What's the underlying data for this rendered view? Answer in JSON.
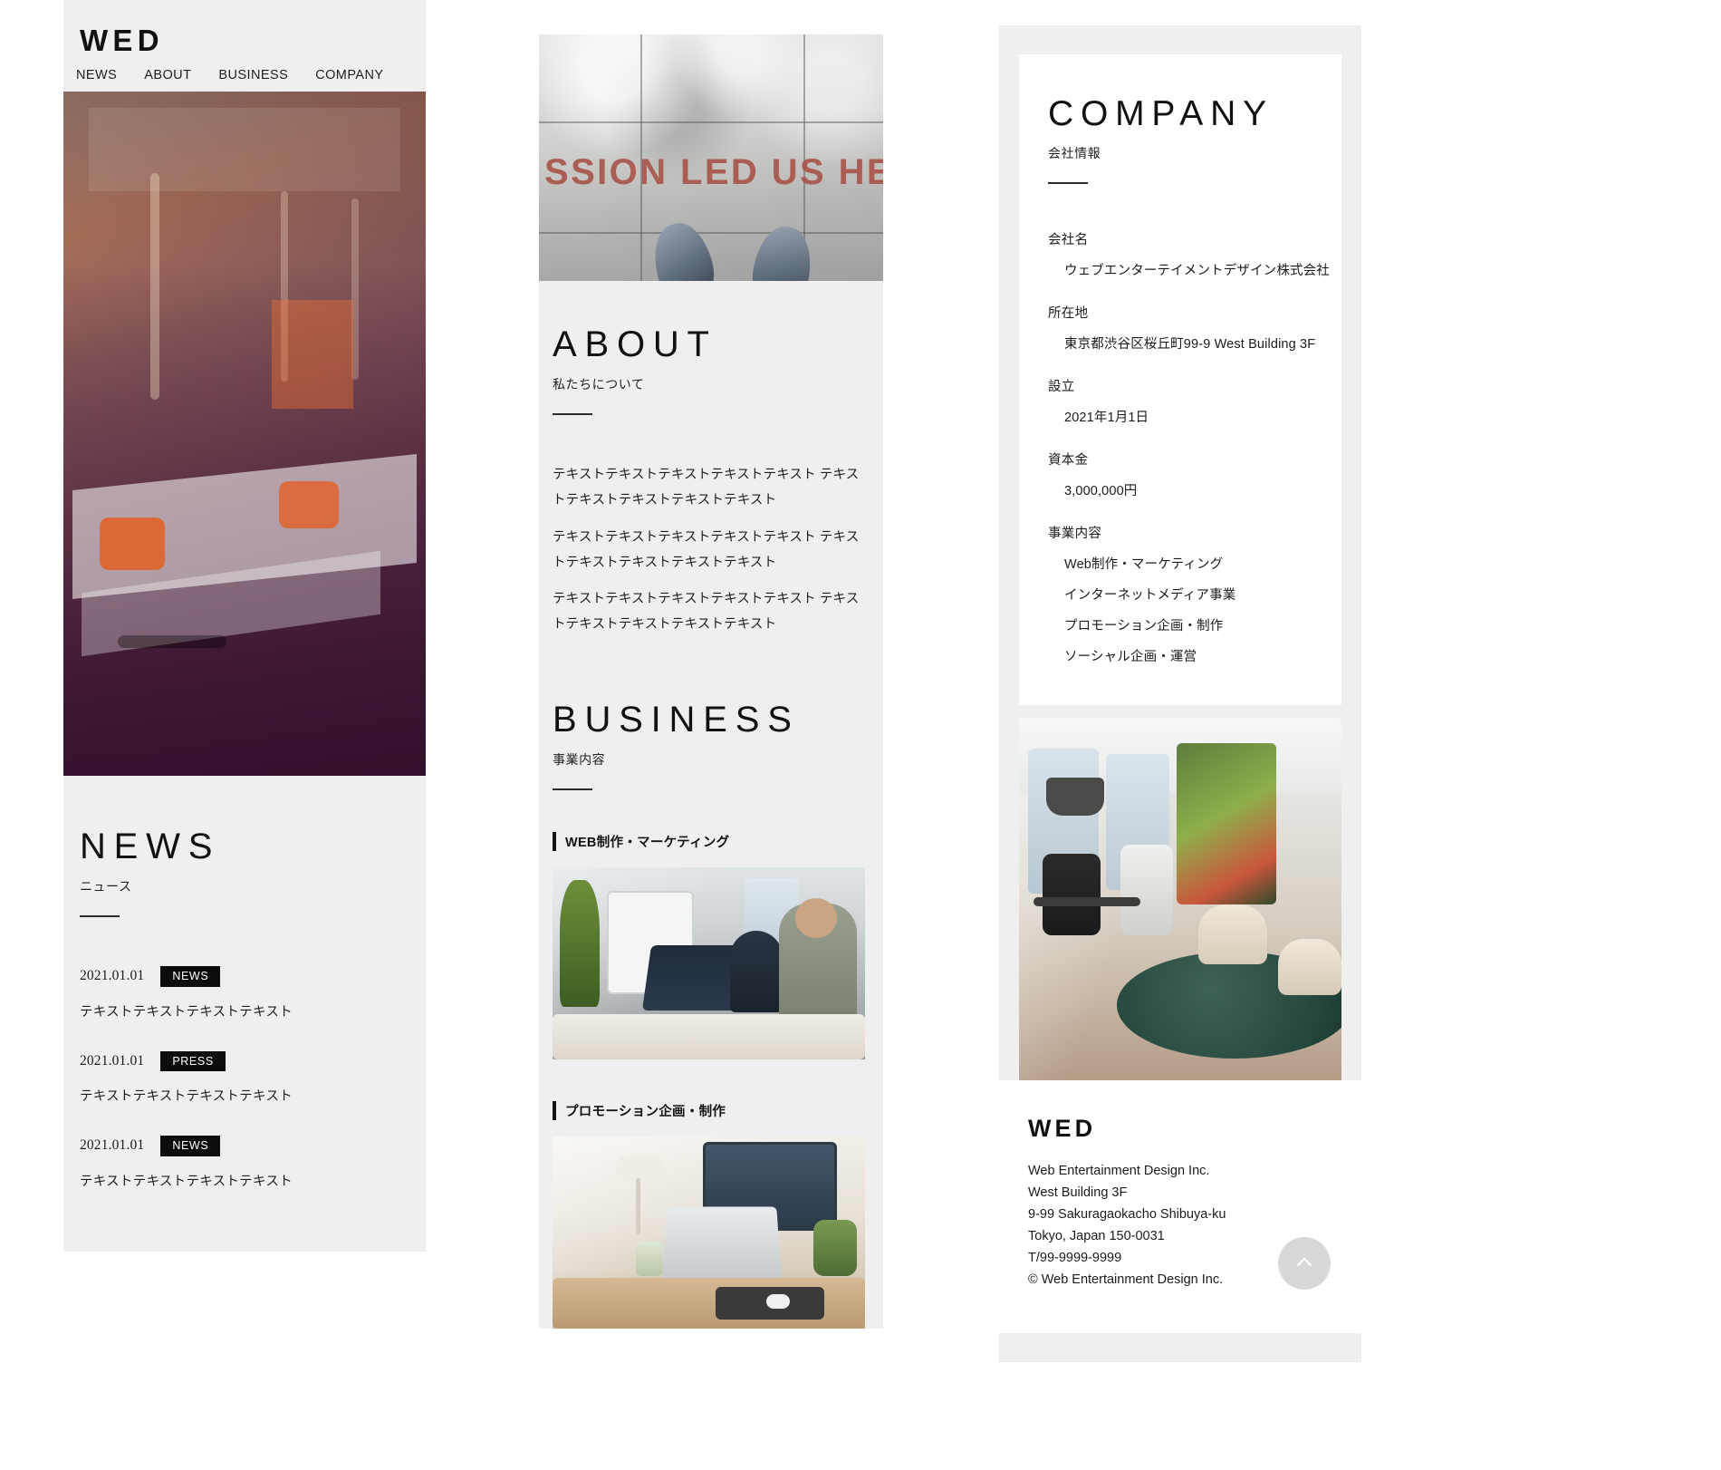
{
  "site": {
    "logo": "WED",
    "nav": [
      {
        "label": "NEWS"
      },
      {
        "label": "ABOUT"
      },
      {
        "label": "BUSINESS"
      },
      {
        "label": "COMPANY"
      }
    ]
  },
  "news": {
    "title": "NEWS",
    "subtitle": "ニュース",
    "items": [
      {
        "date": "2021.01.01",
        "tag": "NEWS",
        "text": "テキストテキストテキストテキスト"
      },
      {
        "date": "2021.01.01",
        "tag": "PRESS",
        "text": "テキストテキストテキストテキスト"
      },
      {
        "date": "2021.01.01",
        "tag": "NEWS",
        "text": "テキストテキストテキストテキスト"
      }
    ]
  },
  "hero2": {
    "wall_text": "SSION LED US HE"
  },
  "about": {
    "title": "ABOUT",
    "subtitle": "私たちについて",
    "paragraphs": [
      "テキストテキストテキストテキストテキスト テキストテキストテキストテキストテキスト",
      "テキストテキストテキストテキストテキスト テキストテキストテキストテキストテキスト",
      "テキストテキストテキストテキストテキスト テキストテキストテキストテキストテキスト"
    ]
  },
  "business": {
    "title": "BUSINESS",
    "subtitle": "事業内容",
    "items": [
      {
        "label": "WEB制作・マーケティング"
      },
      {
        "label": "プロモーション企画・制作"
      }
    ]
  },
  "company": {
    "title": "COMPANY",
    "subtitle": "会社情報",
    "rows": [
      {
        "label": "会社名",
        "values": [
          "ウェブエンターテイメントデザイン株式会社"
        ]
      },
      {
        "label": "所在地",
        "values": [
          "東京都渋谷区桜丘町99-9 West Building 3F"
        ]
      },
      {
        "label": "設立",
        "values": [
          "2021年1月1日"
        ]
      },
      {
        "label": "資本金",
        "values": [
          "3,000,000円"
        ]
      },
      {
        "label": "事業内容",
        "values": [
          "Web制作・マーケティング",
          "インターネットメディア事業",
          "プロモーション企画・制作",
          "ソーシャル企画・運営"
        ]
      }
    ]
  },
  "footer": {
    "logo": "WED",
    "lines": [
      "Web Entertainment Design Inc.",
      "West Building 3F",
      "9-99 Sakuragaokacho Shibuya-ku",
      "Tokyo, Japan 150-0031",
      "T/99-9999-9999",
      "© Web Entertainment Design Inc."
    ],
    "to_top_icon": "chevron-up-circle-icon"
  },
  "colors": {
    "panel_bg": "#efefef",
    "card_bg": "#ffffff",
    "text": "#1a1a1a",
    "tag_bg": "#0d0d0d",
    "accent_bar": "#141414",
    "to_top_bg": "#d8d8d8"
  }
}
